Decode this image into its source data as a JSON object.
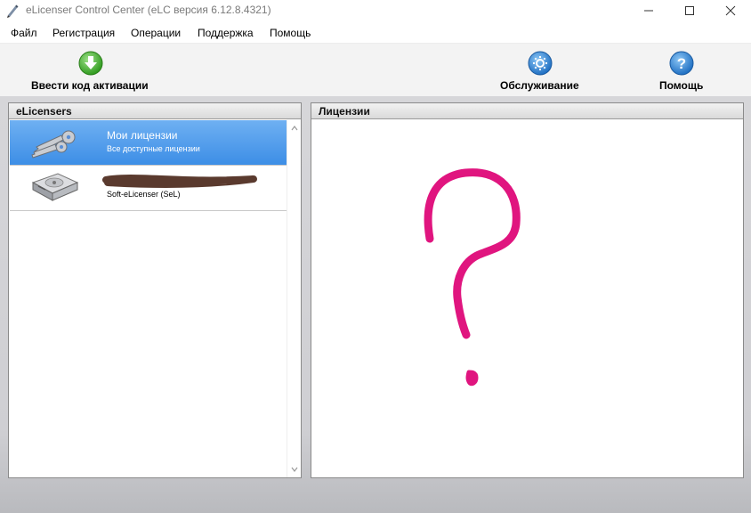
{
  "window": {
    "title": "eLicenser Control Center (eLC версия 6.12.8.4321)",
    "controls": [
      "minimize-icon",
      "maximize-icon",
      "close-icon"
    ]
  },
  "menu": {
    "items": [
      "Файл",
      "Регистрация",
      "Операции",
      "Поддержка",
      "Помощь"
    ]
  },
  "toolbar": {
    "enter_code_label": "Ввести код активации",
    "service_label": "Обслуживание",
    "help_label": "Помощь"
  },
  "left_panel": {
    "header": "eLicensers",
    "items": [
      {
        "title": "Мои лицензии",
        "subtitle": "Все доступные лицензии",
        "icon": "keys-icon",
        "selected": true
      },
      {
        "title": "",
        "subtitle": "Soft-eLicenser (SeL)",
        "icon": "hard-drive-icon",
        "selected": false
      }
    ]
  },
  "right_panel": {
    "header": "Лицензии"
  },
  "colors": {
    "selection": "#3d8ee6",
    "annotation": "#e0157f",
    "redaction": "#5a3a2e"
  }
}
